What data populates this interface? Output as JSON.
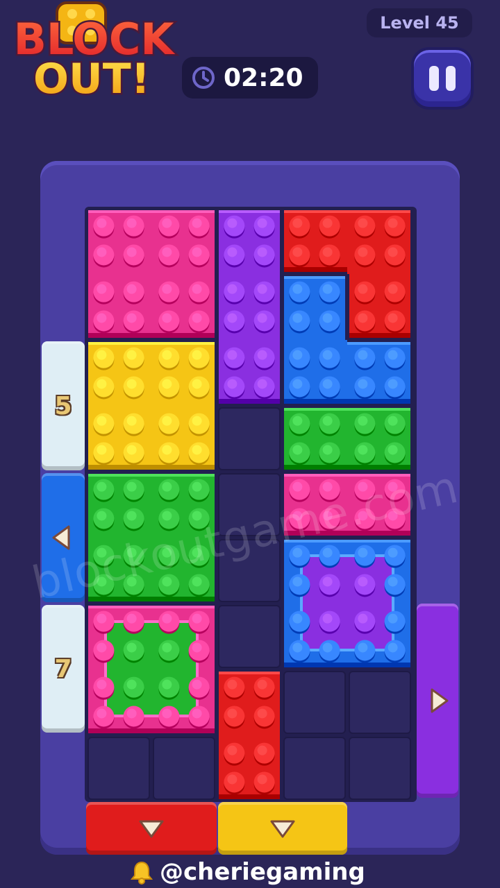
{
  "game": {
    "logo_line1": "BLOCK",
    "logo_line2": "OUT!",
    "level_label": "Level 45",
    "timer": "02:20",
    "watermark": "blockoutgame.com",
    "credit": "@cheriegaming"
  },
  "board": {
    "columns": 5,
    "rows": 9,
    "blocks": [
      {
        "name": "pink-block-top-left",
        "color": "#e8318f",
        "cells": [
          [
            0,
            0
          ],
          [
            1,
            0
          ],
          [
            0,
            1
          ],
          [
            1,
            1
          ]
        ]
      },
      {
        "name": "purple-block-vertical",
        "color": "#8a2fe0",
        "cells": [
          [
            2,
            0
          ],
          [
            2,
            1
          ],
          [
            2,
            2
          ]
        ]
      },
      {
        "name": "red-block-top-right",
        "color": "#e01c1c",
        "cells": [
          [
            3,
            0
          ],
          [
            4,
            0
          ],
          [
            4,
            1
          ]
        ]
      },
      {
        "name": "blue-block-l-shape",
        "color": "#1f6ee8",
        "cells": [
          [
            3,
            1
          ],
          [
            3,
            2
          ],
          [
            4,
            2
          ]
        ]
      },
      {
        "name": "yellow-block",
        "color": "#f5c515",
        "cells": [
          [
            0,
            2
          ],
          [
            1,
            2
          ],
          [
            0,
            3
          ],
          [
            1,
            3
          ]
        ]
      },
      {
        "name": "green-block-right",
        "color": "#22b52f",
        "cells": [
          [
            3,
            3
          ],
          [
            4,
            3
          ]
        ]
      },
      {
        "name": "green-block-left",
        "color": "#22b52f",
        "cells": [
          [
            0,
            4
          ],
          [
            1,
            4
          ],
          [
            0,
            5
          ],
          [
            1,
            5
          ]
        ]
      },
      {
        "name": "pink-block-right",
        "color": "#e8318f",
        "cells": [
          [
            3,
            4
          ],
          [
            4,
            4
          ]
        ]
      },
      {
        "name": "blue-block-with-purple-core",
        "color": "#1f6ee8",
        "inner": "#8a2fe0",
        "cells": [
          [
            3,
            5
          ],
          [
            4,
            5
          ],
          [
            3,
            6
          ],
          [
            4,
            6
          ]
        ]
      },
      {
        "name": "pink-block-with-green-core",
        "color": "#e8318f",
        "inner": "#22b52f",
        "cells": [
          [
            0,
            6
          ],
          [
            1,
            6
          ],
          [
            0,
            7
          ],
          [
            1,
            7
          ]
        ]
      },
      {
        "name": "red-block-bottom",
        "color": "#e01c1c",
        "cells": [
          [
            2,
            7
          ],
          [
            2,
            8
          ]
        ]
      }
    ],
    "gates": [
      {
        "name": "locked-gate-5",
        "side": "left",
        "color": "#dfeef5",
        "label": "5"
      },
      {
        "name": "blue-exit-gate-left",
        "side": "left",
        "color": "#1f6ee8",
        "arrow": "left"
      },
      {
        "name": "locked-gate-7",
        "side": "left",
        "color": "#dfeef5",
        "label": "7"
      },
      {
        "name": "purple-exit-gate-right",
        "side": "right",
        "color": "#8a2fe0",
        "arrow": "right"
      },
      {
        "name": "red-exit-gate-bottom",
        "side": "bottom",
        "color": "#e01c1c",
        "arrow": "down"
      },
      {
        "name": "yellow-exit-gate-bottom",
        "side": "bottom",
        "color": "#f5c515",
        "arrow": "down"
      }
    ]
  }
}
